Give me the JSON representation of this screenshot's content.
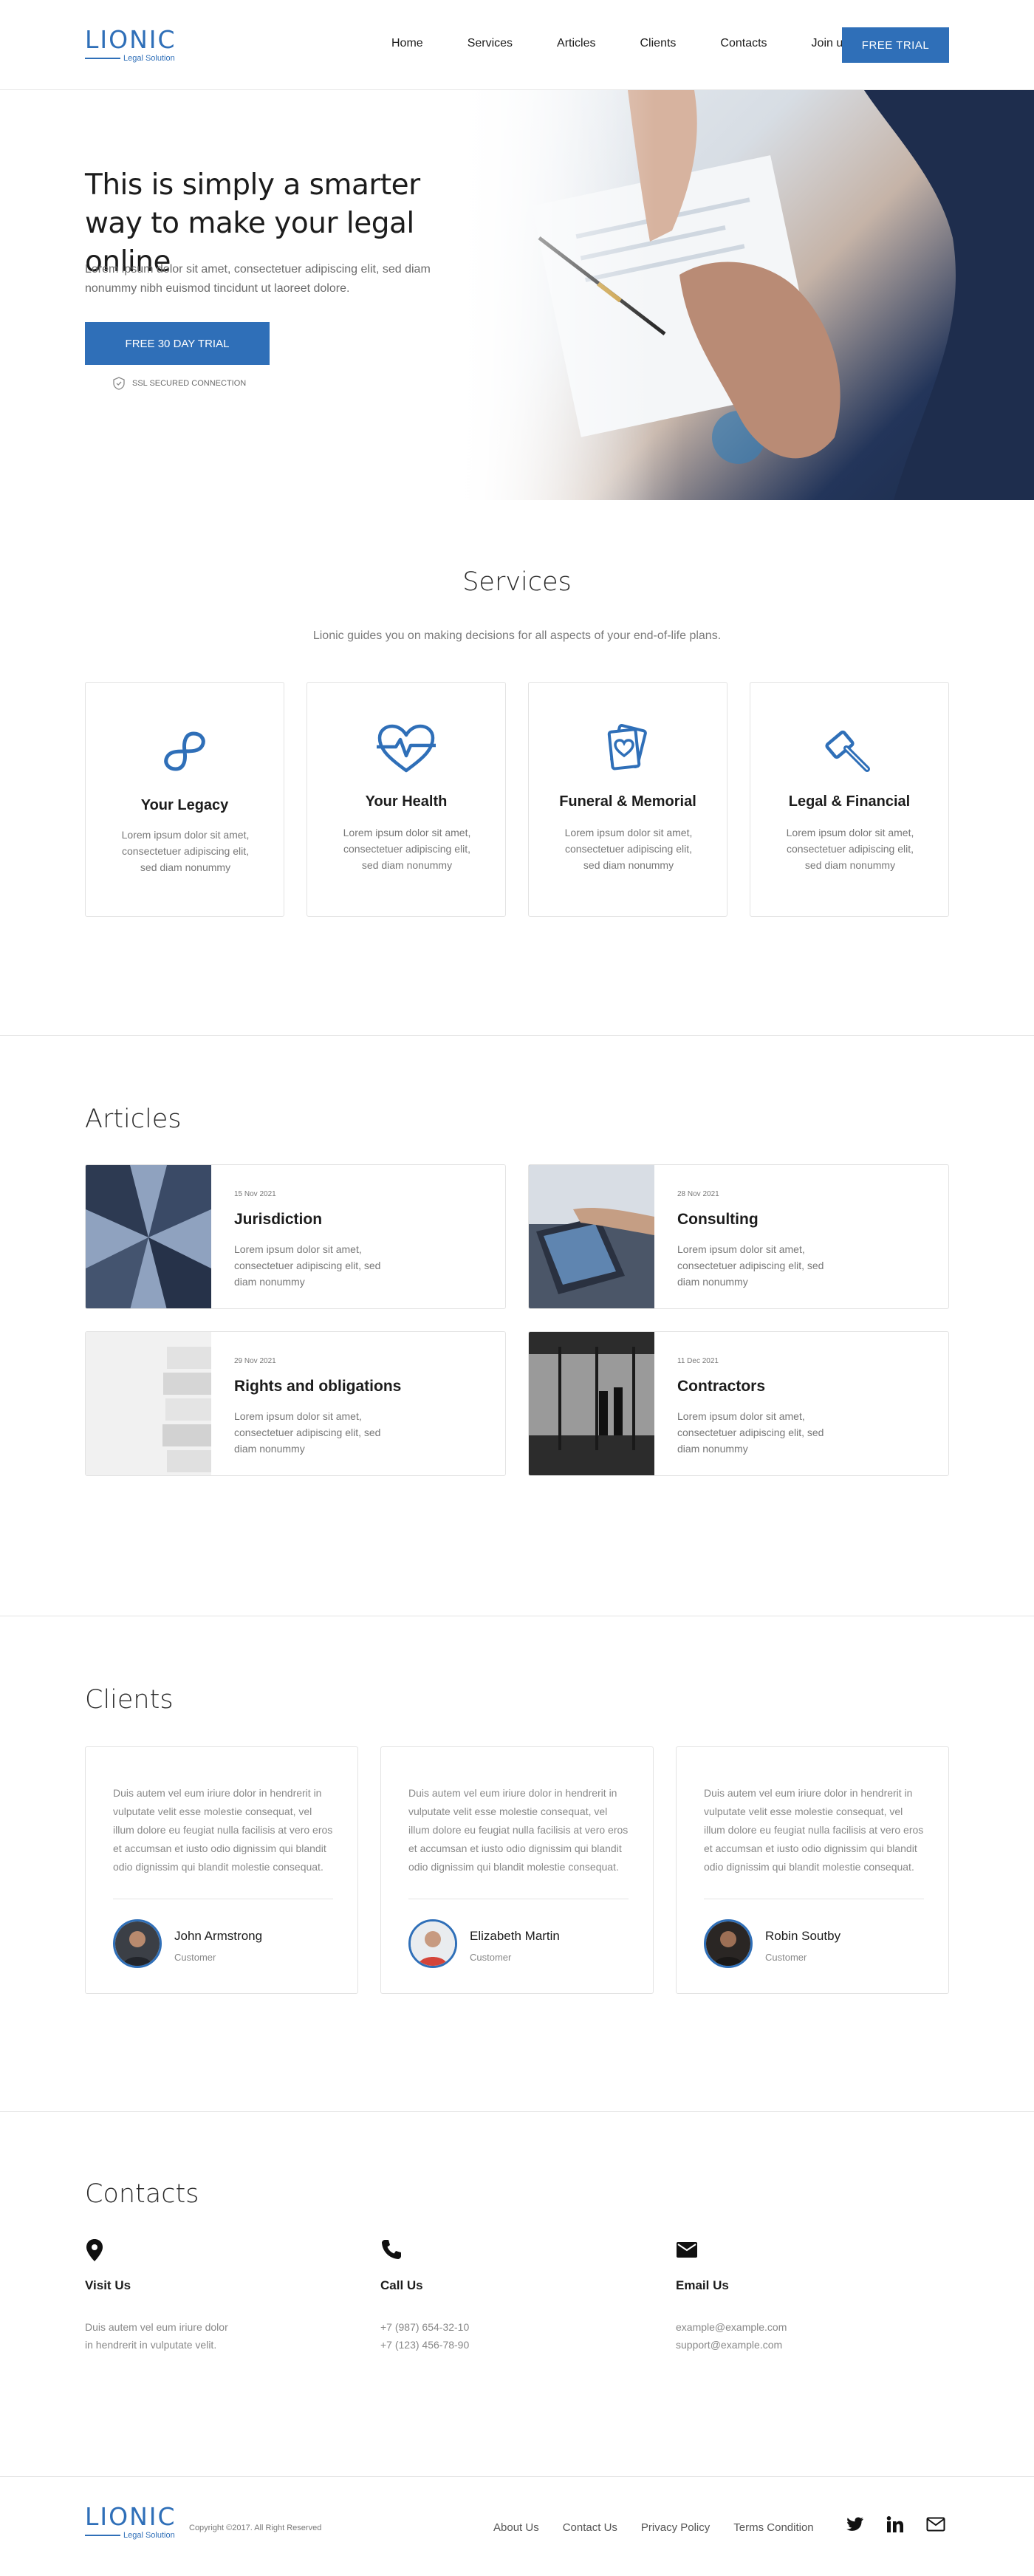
{
  "brand": {
    "name": "LIONIC",
    "tagline": "Legal Solution",
    "color": "#2f6fb8"
  },
  "nav": [
    {
      "label": "Home"
    },
    {
      "label": "Services"
    },
    {
      "label": "Articles"
    },
    {
      "label": "Clients"
    },
    {
      "label": "Contacts"
    },
    {
      "label": "Join us"
    }
  ],
  "header_cta": "FREE TRIAL",
  "hero": {
    "title": "This is simply a smarter way to make your legal online",
    "text": "Lorem ipsum dolor sit amet, consectetuer adipiscing elit, sed diam nonummy nibh euismod tincidunt ut laoreet dolore.",
    "cta": "FREE 30 DAY TRIAL",
    "ssl": "SSL SECURED CONNECTION"
  },
  "services": {
    "title": "Services",
    "subtitle": "Lionic guides you on making decisions for all aspects of your end-of-life plans.",
    "items": [
      {
        "icon": "infinity-icon",
        "title": "Your Legacy",
        "text": "Lorem ipsum dolor sit amet, consectetuer adipiscing elit, sed diam nonummy"
      },
      {
        "icon": "heart-pulse-icon",
        "title": "Your Health",
        "text": "Lorem ipsum dolor sit amet, consectetuer adipiscing elit, sed diam nonummy"
      },
      {
        "icon": "cards-icon",
        "title": "Funeral & Memorial",
        "text": "Lorem ipsum dolor sit amet, consectetuer adipiscing elit, sed diam nonummy"
      },
      {
        "icon": "gavel-icon",
        "title": "Legal & Financial",
        "text": "Lorem ipsum dolor sit amet, consectetuer adipiscing elit, sed diam nonummy"
      }
    ]
  },
  "articles": {
    "title": "Articles",
    "items": [
      {
        "date": "15 Nov 2021",
        "title": "Jurisdiction",
        "text": "Lorem ipsum dolor sit amet, consectetuer adipiscing elit, sed diam nonummy"
      },
      {
        "date": "28 Nov 2021",
        "title": "Consulting",
        "text": "Lorem ipsum dolor sit amet, consectetuer adipiscing elit, sed diam nonummy"
      },
      {
        "date": "29 Nov 2021",
        "title": "Rights and obligations",
        "text": "Lorem ipsum dolor sit amet, consectetuer adipiscing elit, sed diam nonummy"
      },
      {
        "date": "11 Dec 2021",
        "title": "Contractors",
        "text": "Lorem ipsum dolor sit amet, consectetuer adipiscing elit, sed diam nonummy"
      }
    ]
  },
  "clients": {
    "title": "Clients",
    "items": [
      {
        "quote": "Duis autem vel eum iriure dolor in hendrerit in vulputate velit esse molestie consequat, vel illum dolore eu feugiat nulla facilisis at vero eros et accumsan et iusto odio dignissim qui blandit odio dignissim qui blandit molestie consequat.",
        "name": "John Armstrong",
        "role": "Customer"
      },
      {
        "quote": "Duis autem vel eum iriure dolor in hendrerit in vulputate velit esse molestie consequat, vel illum dolore eu feugiat nulla facilisis at vero eros et accumsan et iusto odio dignissim qui blandit odio dignissim qui blandit molestie consequat.",
        "name": "Elizabeth Martin",
        "role": "Customer"
      },
      {
        "quote": "Duis autem vel eum iriure dolor in hendrerit in vulputate velit esse molestie consequat, vel illum dolore eu feugiat nulla facilisis at vero eros et accumsan et iusto odio dignissim qui blandit odio dignissim qui blandit molestie consequat.",
        "name": "Robin Soutby",
        "role": "Customer"
      }
    ]
  },
  "contacts": {
    "title": "Contacts",
    "items": [
      {
        "icon": "location-pin-icon",
        "title": "Visit Us",
        "lines": [
          "Duis autem vel eum iriure dolor",
          "in hendrerit in vulputate velit."
        ]
      },
      {
        "icon": "phone-icon",
        "title": "Call Us",
        "lines": [
          "+7 (987) 654-32-10",
          "+7 (123) 456-78-90"
        ]
      },
      {
        "icon": "mail-icon",
        "title": "Email Us",
        "lines": [
          "example@example.com",
          "support@example.com"
        ]
      }
    ]
  },
  "footer": {
    "copyright": "Copyright ©2017. All Right Reserved",
    "links": [
      "About Us",
      "Contact Us",
      "Privacy Policy",
      "Terms Condition"
    ],
    "social": [
      "twitter-icon",
      "linkedin-icon",
      "mail-icon"
    ]
  }
}
